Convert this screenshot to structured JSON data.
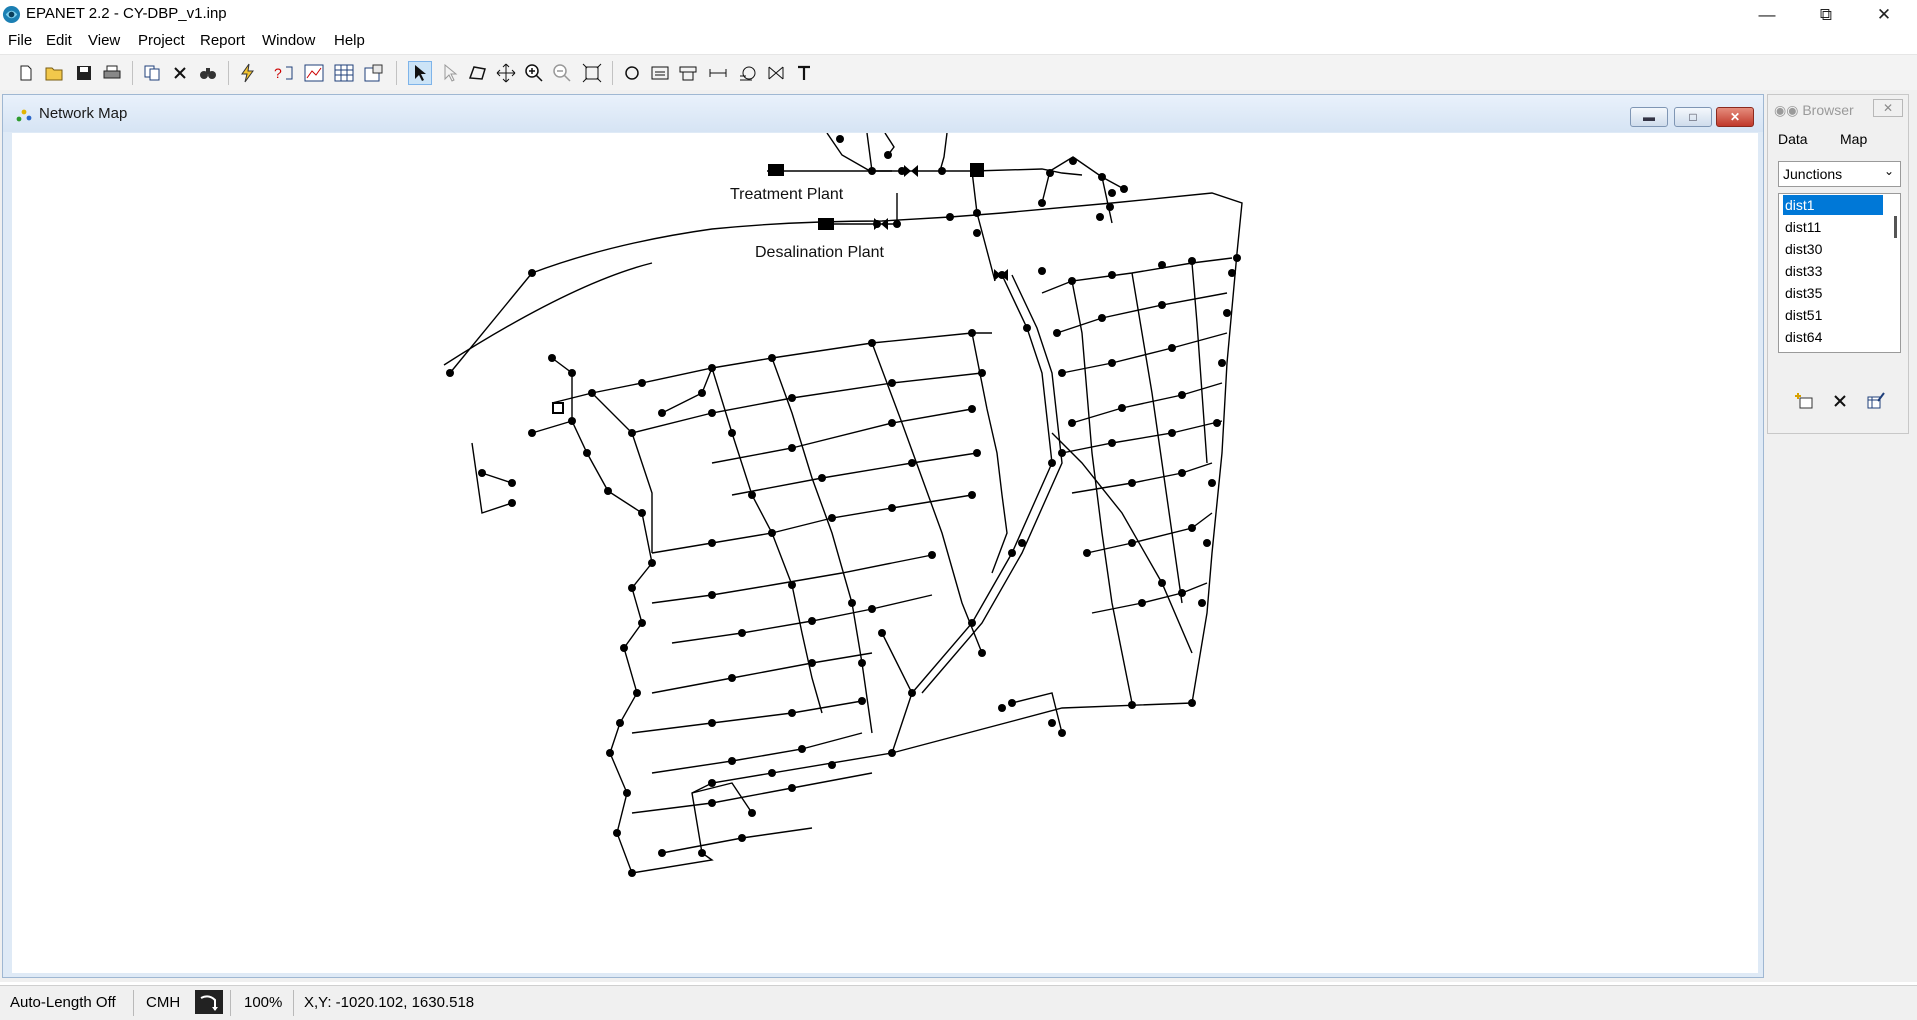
{
  "window": {
    "title": "EPANET 2.2 - CY-DBP_v1.inp",
    "controls": [
      "minimize-icon",
      "restore-icon",
      "close-icon"
    ]
  },
  "menu": {
    "items": [
      "File",
      "Edit",
      "View",
      "Project",
      "Report",
      "Window",
      "Help"
    ]
  },
  "toolbar": {
    "icons": [
      "new-file-icon",
      "open-folder-icon",
      "save-icon",
      "print-icon",
      "copy-icon",
      "delete-icon",
      "find-icon",
      "run-lightning-icon",
      "query-icon",
      "graph-icon",
      "table-icon",
      "options-icon",
      "select-arrow-icon",
      "select-vertex-icon",
      "select-region-icon",
      "pan-icon",
      "zoom-in-icon",
      "zoom-out-icon",
      "full-extent-icon",
      "add-junction-icon",
      "add-reservoir-icon",
      "add-tank-icon",
      "add-pipe-icon",
      "add-pump-icon",
      "add-valve-icon",
      "add-label-icon"
    ]
  },
  "network_map": {
    "title": "Network Map",
    "labels": {
      "treatment_plant": "Treatment Plant",
      "desalination_plant": "Desalination Plant"
    }
  },
  "browser": {
    "title": "Browser",
    "tabs": [
      "Data",
      "Map"
    ],
    "active_tab": "Data",
    "object_type": "Junctions",
    "items": [
      "dist1",
      "dist11",
      "dist30",
      "dist33",
      "dist35",
      "dist51",
      "dist64"
    ],
    "selected_item": "dist1",
    "actions": [
      "add-object-icon",
      "delete-object-icon",
      "edit-object-icon"
    ]
  },
  "status": {
    "auto_length": "Auto-Length Off",
    "flow_units": "CMH",
    "zoom": "100%",
    "coordinates": "X,Y: -1020.102, 1630.518"
  },
  "colors": {
    "selection": "#0078d7",
    "map_background": "#ffffff",
    "mdi_close": "#c0392b"
  }
}
